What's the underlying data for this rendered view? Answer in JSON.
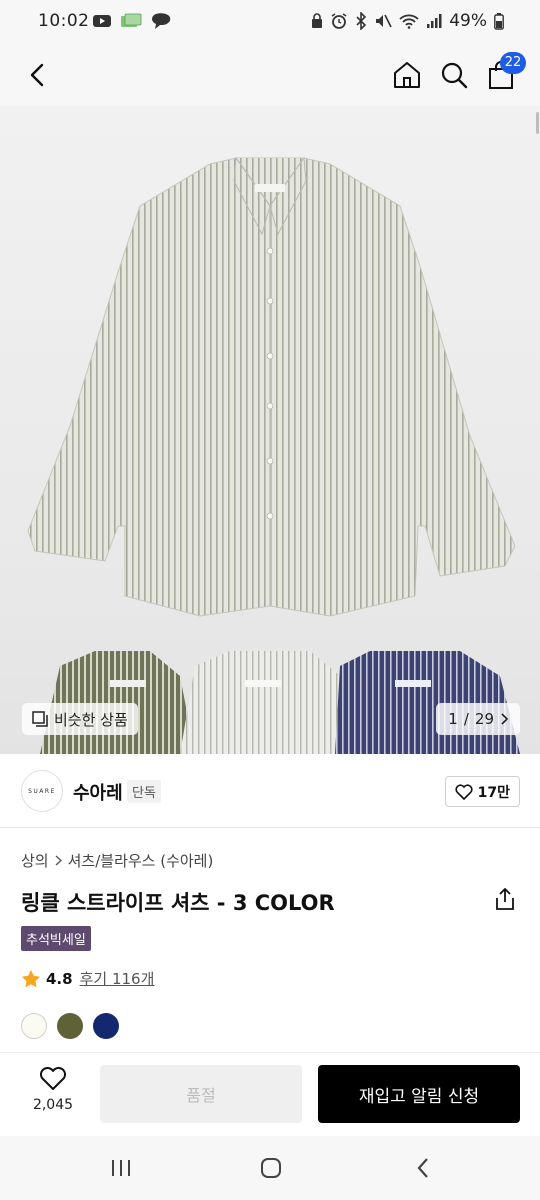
{
  "status_bar": {
    "time": "10:02",
    "battery": "49%"
  },
  "header": {
    "cart_count": "22"
  },
  "hero": {
    "similar_label": "비슷한 상품",
    "page_current": "1",
    "page_separator": "/",
    "page_total": "29"
  },
  "brand": {
    "logo_text": "SUARE",
    "name": "수아레",
    "tag": "단독",
    "likes": "17만"
  },
  "breadcrumb": {
    "level1": "상의",
    "level2": "셔츠/블라우스 (수아레)"
  },
  "product": {
    "title": "링클 스트라이프 셔츠 - 3 COLOR",
    "promo_badge": "추석빅세일",
    "rating": "4.8",
    "review_label": "후기 116개",
    "swatches": [
      "#fbfbf1",
      "#5e6236",
      "#13286e"
    ]
  },
  "bottom_bar": {
    "wish_count": "2,045",
    "soldout_label": "품절",
    "restock_label": "재입고 알림 신청"
  },
  "colors": {
    "accent_badge": "#1e5be6",
    "promo": "#5f4a6f"
  }
}
